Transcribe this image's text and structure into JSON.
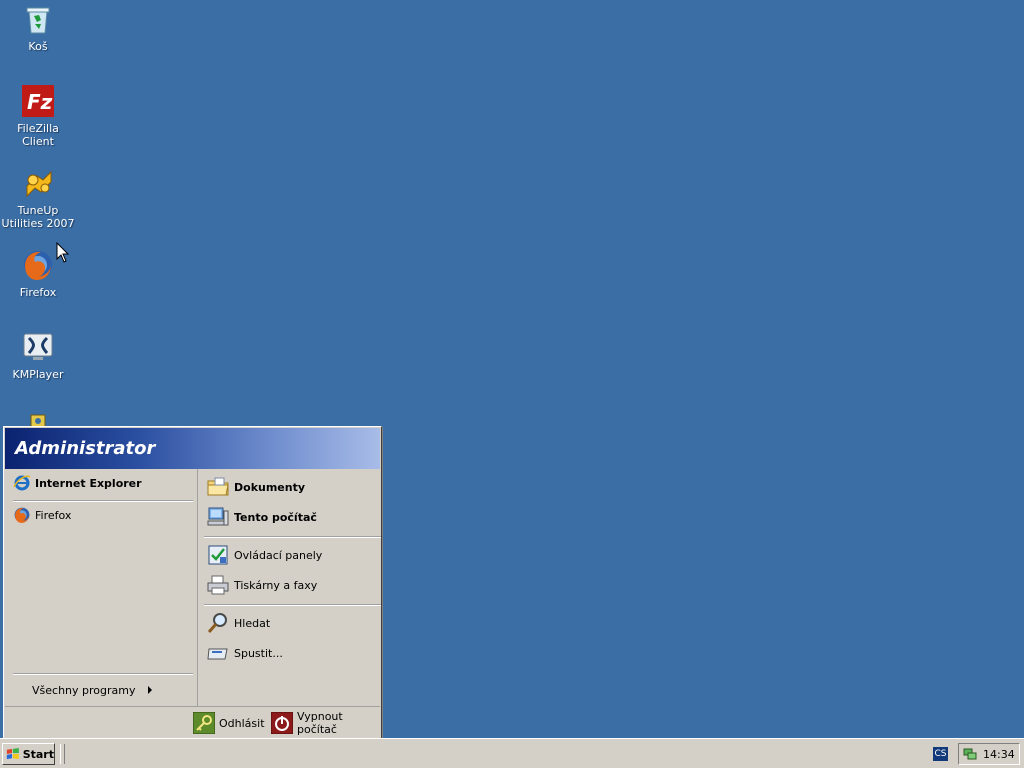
{
  "desktop": {
    "icons": [
      {
        "label": "Koš",
        "icon": "recycle-bin-icon"
      },
      {
        "label": "FileZilla Client",
        "icon": "filezilla-icon"
      },
      {
        "label": "TuneUp Utilities 2007",
        "icon": "tuneup-icon"
      },
      {
        "label": "Firefox",
        "icon": "firefox-icon"
      },
      {
        "label": "KMPlayer",
        "icon": "kmplayer-icon"
      }
    ]
  },
  "start_menu": {
    "user": "Administrator",
    "pinned": [
      {
        "label": "Internet Explorer",
        "icon": "internet-explorer-icon"
      }
    ],
    "recent": [
      {
        "label": "Firefox",
        "icon": "firefox-icon"
      }
    ],
    "all_programs": "Všechny programy",
    "right": [
      {
        "label": "Dokumenty",
        "icon": "folder-icon"
      },
      {
        "label": "Tento počítač",
        "icon": "computer-icon"
      },
      {
        "label": "Ovládací panely",
        "icon": "control-panel-icon"
      },
      {
        "label": "Tiskárny a faxy",
        "icon": "printer-icon"
      },
      {
        "label": "Hledat",
        "icon": "search-icon"
      },
      {
        "label": "Spustit...",
        "icon": "run-icon"
      }
    ],
    "logoff": "Odhlásit",
    "shutdown": "Vypnout počítač"
  },
  "taskbar": {
    "start_label": "Start",
    "language": "CS",
    "clock": "14:34"
  },
  "colors": {
    "desktop": "#3b6ea5",
    "chrome": "#d4d0c8",
    "menu_header": "#0b2370"
  }
}
